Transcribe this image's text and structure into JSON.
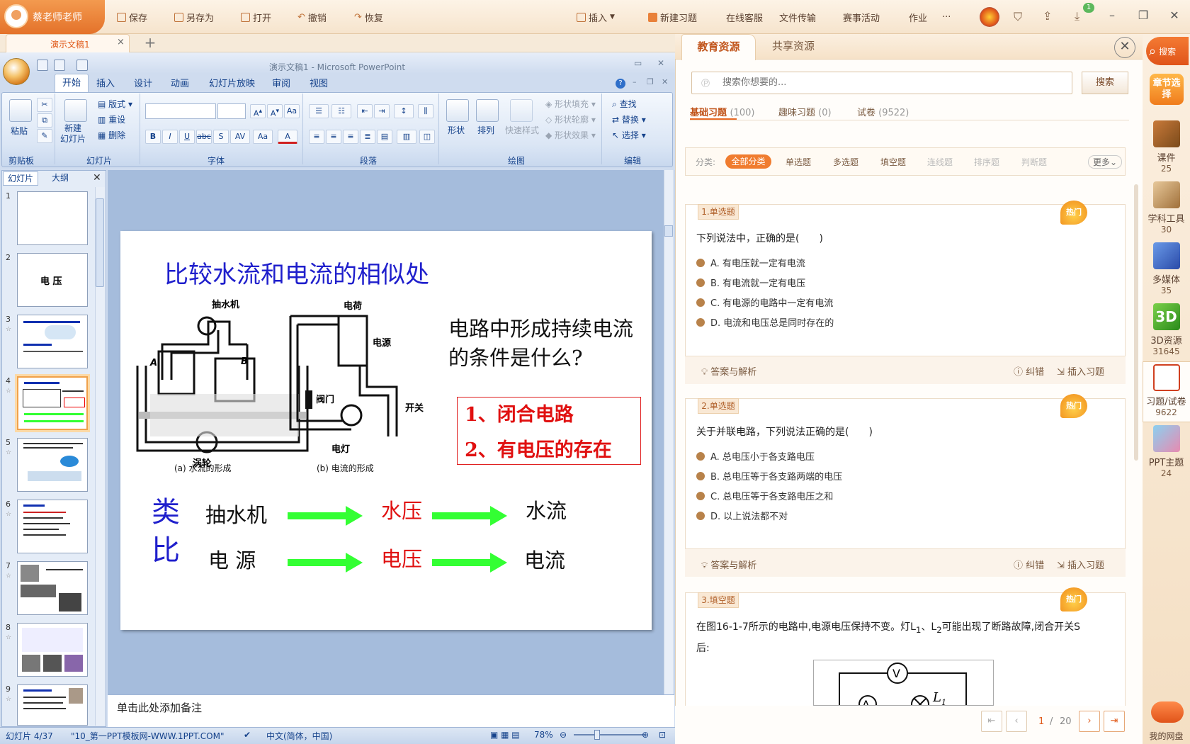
{
  "appbar": {
    "username": "蔡老师老师",
    "buttons": [
      "保存",
      "另存为",
      "打开",
      "撤销",
      "恢复"
    ],
    "right_buttons": [
      "插入",
      "新建习题",
      "在线客服",
      "文件传输",
      "赛事活动",
      "作业",
      "···"
    ],
    "download_badge": "1"
  },
  "tabs": {
    "doc_tab": "演示文稿1",
    "close": "×",
    "new_tab": "+"
  },
  "ppt": {
    "window_title": "演示文稿1 - Microsoft PowerPoint",
    "ribbon_tabs": [
      "开始",
      "插入",
      "设计",
      "动画",
      "幻灯片放映",
      "审阅",
      "视图"
    ],
    "groups": {
      "clipboard": {
        "label": "剪贴板",
        "paste": "粘贴"
      },
      "slides": {
        "label": "幻灯片",
        "new_slide": "新建\n幻灯片",
        "layout": "版式",
        "reset": "重设",
        "delete": "删除"
      },
      "font": {
        "label": "字体"
      },
      "paragraph": {
        "label": "段落"
      },
      "drawing": {
        "label": "绘图",
        "shape": "形状",
        "arrange": "排列",
        "quick_styles": "快速样式",
        "fill": "形状填充",
        "outline": "形状轮廓",
        "effects": "形状效果"
      },
      "editing": {
        "label": "编辑",
        "find": "查找",
        "replace": "替换",
        "select": "选择"
      }
    },
    "panel_tabs": [
      "幻灯片",
      "大纲"
    ],
    "slide_numbers": [
      "1",
      "2",
      "3",
      "4",
      "5",
      "6",
      "7",
      "8",
      "9"
    ],
    "thumb2_title": "电 压",
    "slide": {
      "title": "比较水流和电流的相似处",
      "question": "电路中形成持续电流的条件是什么?",
      "answers": [
        "1、闭合电路",
        "2、有电压的存在"
      ],
      "analogy_label": "类比",
      "row1": [
        "抽水机",
        "水压",
        "水流"
      ],
      "row2": [
        "电 源",
        "电压",
        "电流"
      ],
      "diagram_a": {
        "pump": "抽水机",
        "a": "A",
        "b": "B",
        "valve": "阀门",
        "turbine": "涡轮",
        "caption": "(a) 水流的形成"
      },
      "diagram_b": {
        "charge": "电荷",
        "source": "电源",
        "switch": "开关",
        "lamp": "电灯",
        "caption": "(b) 电流的形成"
      }
    },
    "notes": "单击此处添加备注",
    "status": {
      "slide": "幻灯片 4/37",
      "theme": "\"10_第一PPT模板网-WWW.1PPT.COM\"",
      "lang": "中文(简体，中国)",
      "zoom": "78%"
    }
  },
  "resources": {
    "tabs": [
      "教育资源",
      "共享资源"
    ],
    "search_placeholder": "搜索你想要的...",
    "search_button": "搜索",
    "type_tabs": [
      {
        "label": "基础习题",
        "count": "(100)"
      },
      {
        "label": "趣味习题",
        "count": "(0)"
      },
      {
        "label": "试卷",
        "count": "(9522)"
      }
    ],
    "filter_label": "分类:",
    "filters": [
      "全部分类",
      "单选题",
      "多选题",
      "填空题",
      "连线题",
      "排序题",
      "判断题",
      "更多"
    ],
    "hot": "热门",
    "q1": {
      "tag": "1.单选题",
      "text": "下列说法中，正确的是(　　)",
      "options": [
        "A. 有电压就一定有电流",
        "B. 有电流就一定有电压",
        "C. 有电源的电路中一定有电流",
        "D. 电流和电压总是同时存在的"
      ]
    },
    "q2": {
      "tag": "2.单选题",
      "text": "关于并联电路，下列说法正确的是(　　)",
      "options": [
        "A. 总电压小于各支路电压",
        "B. 总电压等于各支路两端的电压",
        "C. 总电压等于各支路电压之和",
        "D. 以上说法都不对"
      ]
    },
    "q3": {
      "tag": "3.填空题",
      "text_a": "在图16-1-7所示的电路中,电源电压保持不变。灯L",
      "sub1": "1",
      "text_b": "、L",
      "sub2": "2",
      "text_c": "可能出现了断路故障,闭合开关S",
      "text_d": "后:"
    },
    "footer": {
      "analysis": "答案与解析",
      "report": "纠错",
      "insert": "插入习题"
    },
    "pager": {
      "current": "1",
      "sep": "/",
      "total": "20"
    }
  },
  "sidebar": {
    "search": "搜索",
    "chapter": "章节选择",
    "items": [
      {
        "label": "课件",
        "count": "25"
      },
      {
        "label": "学科工具",
        "count": "30"
      },
      {
        "label": "多媒体",
        "count": "35"
      },
      {
        "label": "3D资源",
        "count": "31645"
      },
      {
        "label": "习题/试卷",
        "count": "9622"
      },
      {
        "label": "PPT主题",
        "count": "24"
      }
    ],
    "cloud": "我的网盘"
  },
  "colors": {
    "accent": "#f07c2f",
    "slide_title": "#1f1fcc",
    "answer_red": "#e01010",
    "arrow_green": "#33ff33"
  }
}
